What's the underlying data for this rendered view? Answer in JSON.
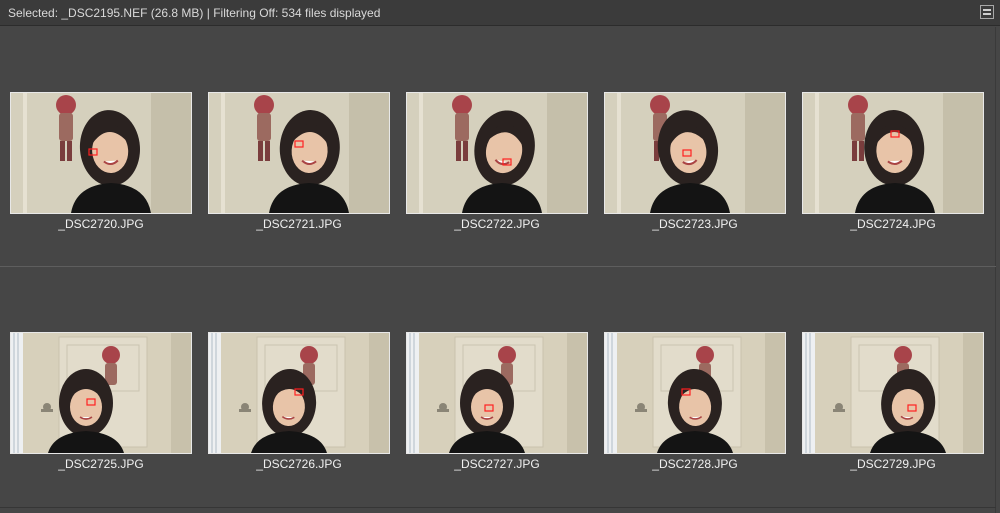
{
  "status": {
    "text": "Selected: _DSC2195.NEF (26.8 MB) | Filtering Off: 534 files displayed"
  },
  "icons": {
    "panel_menu": "panel-menu-icon"
  },
  "colors": {
    "panel_bg": "#464646",
    "status_bg": "#3b3b3b",
    "thumb_border": "#e8e8e8",
    "focus_marker": "#ff2020"
  },
  "thumbnails": [
    {
      "filename": "_DSC2720.JPG"
    },
    {
      "filename": "_DSC2721.JPG"
    },
    {
      "filename": "_DSC2722.JPG"
    },
    {
      "filename": "_DSC2723.JPG"
    },
    {
      "filename": "_DSC2724.JPG"
    },
    {
      "filename": "_DSC2725.JPG"
    },
    {
      "filename": "_DSC2726.JPG"
    },
    {
      "filename": "_DSC2727.JPG"
    },
    {
      "filename": "_DSC2728.JPG"
    },
    {
      "filename": "_DSC2729.JPG"
    }
  ]
}
